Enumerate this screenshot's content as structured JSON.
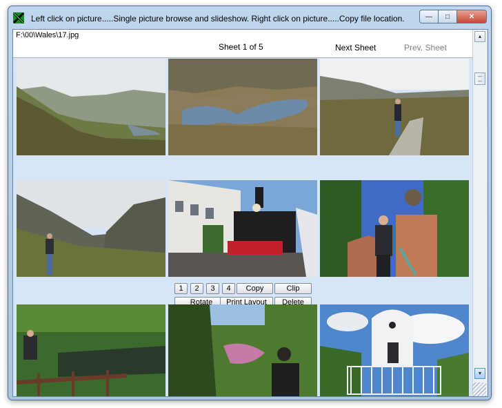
{
  "window": {
    "title": "Left click on picture.....Single picture browse and slideshow.   Right click on picture.....Copy file location.",
    "controls": {
      "minimize": "—",
      "maximize": "□",
      "close": "✕"
    }
  },
  "header": {
    "file_path": "F:\\00\\Wales\\17.jpg",
    "sheet_label": "Sheet 1 of 5",
    "next_sheet": "Next Sheet",
    "prev_sheet": "Prev. Sheet"
  },
  "toolbar": {
    "row1": [
      {
        "id": "1",
        "label": "1"
      },
      {
        "id": "2",
        "label": "2"
      },
      {
        "id": "3",
        "label": "3"
      },
      {
        "id": "4",
        "label": "4"
      },
      {
        "id": "copy",
        "label": "Copy"
      },
      {
        "id": "clip",
        "label": "Clip"
      }
    ],
    "row2": [
      {
        "id": "rotate",
        "label": "Rotate"
      },
      {
        "id": "print",
        "label": "Print Layout"
      },
      {
        "id": "delete",
        "label": "Delete"
      }
    ]
  },
  "thumbnails": [
    {
      "name": "mountain-valley",
      "icon": "photo-icon"
    },
    {
      "name": "mountain-lake",
      "icon": "photo-icon"
    },
    {
      "name": "hiker-on-path",
      "icon": "photo-icon"
    },
    {
      "name": "valley-walker",
      "icon": "photo-icon"
    },
    {
      "name": "steam-locomotive",
      "icon": "photo-icon"
    },
    {
      "name": "woman-by-pillar",
      "icon": "photo-icon"
    },
    {
      "name": "garden-pond",
      "icon": "photo-icon"
    },
    {
      "name": "woodland-visitor",
      "icon": "photo-icon"
    },
    {
      "name": "white-tower",
      "icon": "photo-icon"
    }
  ],
  "colors": {
    "accent": "#d6e6f6",
    "close_button": "#c74a32",
    "prev_disabled": "#808080"
  }
}
